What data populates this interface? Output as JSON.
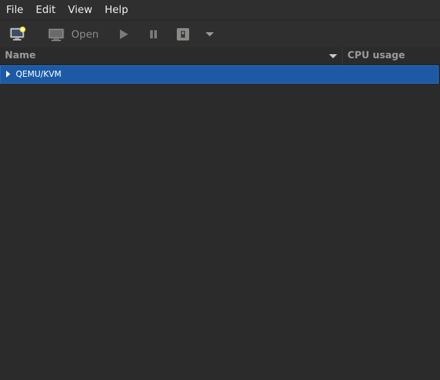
{
  "menubar": {
    "items": [
      {
        "label": "File"
      },
      {
        "label": "Edit"
      },
      {
        "label": "View"
      },
      {
        "label": "Help"
      }
    ]
  },
  "toolbar": {
    "new_vm_icon": "new-vm-icon",
    "open_label": "Open",
    "run_icon": "play-icon",
    "pause_icon": "pause-icon",
    "shutdown_icon": "power-icon",
    "menu_icon": "chevron-down-icon"
  },
  "columns": {
    "name": "Name",
    "cpu": "CPU usage"
  },
  "rows": [
    {
      "label": "QEMU/KVM",
      "expanded": false,
      "selected": true
    }
  ],
  "colors": {
    "selection": "#1c5aa6",
    "background": "#2b2b2b"
  }
}
